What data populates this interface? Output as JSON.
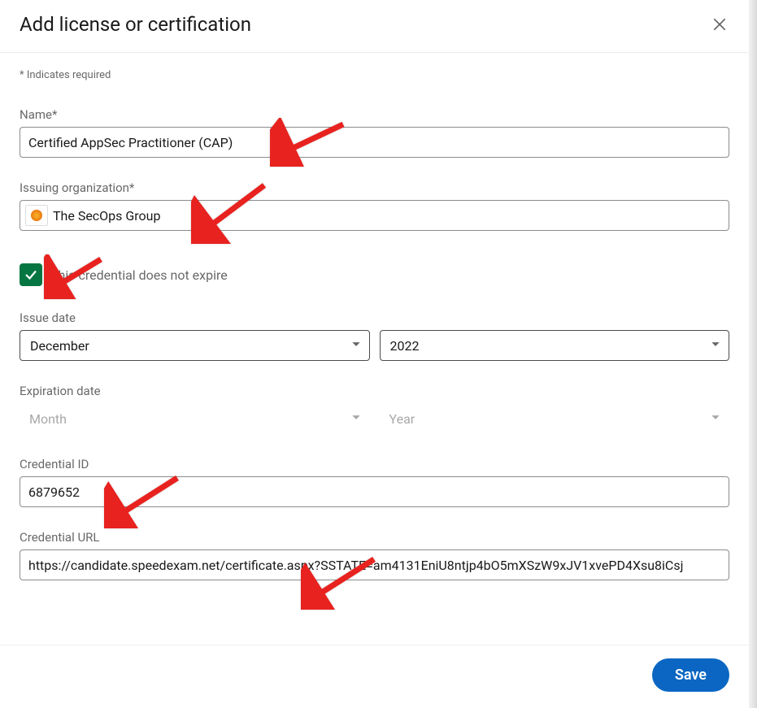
{
  "modal": {
    "title": "Add license or certification",
    "required_note": "* Indicates required",
    "save_label": "Save"
  },
  "fields": {
    "name": {
      "label": "Name*",
      "value": "Certified AppSec Practitioner (CAP)"
    },
    "org": {
      "label": "Issuing organization*",
      "value": "The SecOps Group"
    },
    "no_expire": {
      "label": "This credential does not expire",
      "checked": true
    },
    "issue_date": {
      "label": "Issue date",
      "month": "December",
      "year": "2022"
    },
    "expiration_date": {
      "label": "Expiration date",
      "month_placeholder": "Month",
      "year_placeholder": "Year"
    },
    "credential_id": {
      "label": "Credential ID",
      "value": "6879652"
    },
    "credential_url": {
      "label": "Credential URL",
      "value": "https://candidate.speedexam.net/certificate.aspx?SSTATE=am4131EniU8ntjp4bO5mXSzW9xJV1xvePD4Xsu8iCsj"
    }
  }
}
